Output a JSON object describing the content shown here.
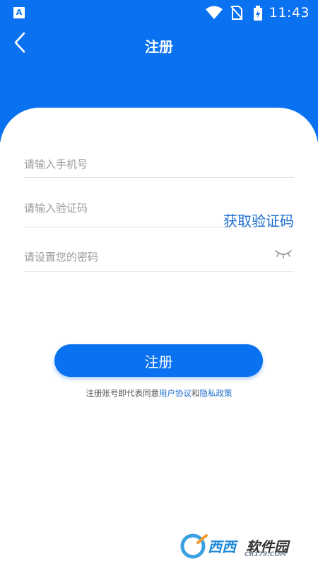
{
  "status_bar": {
    "time": "11:43",
    "app_badge": "A",
    "icons": [
      "wifi-icon",
      "no-sim-icon",
      "battery-charging-icon"
    ]
  },
  "header": {
    "title": "注册",
    "back_icon": "chevron-left-icon"
  },
  "form": {
    "phone_placeholder": "请输入手机号",
    "code_placeholder": "请输入验证码",
    "get_code_label": "获取验证码",
    "password_placeholder": "请设置您的密码",
    "password_toggle_icon": "eye-closed-icon",
    "submit_label": "注册"
  },
  "agreement": {
    "prefix": "注册账号即代表同意",
    "user_agreement": "用户协议",
    "conjunction": "和",
    "privacy_policy": "隐私政策"
  },
  "watermark": {
    "brand": "西西",
    "name": "软件园",
    "site": "CR173.COM"
  },
  "colors": {
    "primary": "#0a72f0",
    "link": "#1f6fcf",
    "placeholder": "#9a9a9a",
    "divider": "#e3e3e3"
  }
}
